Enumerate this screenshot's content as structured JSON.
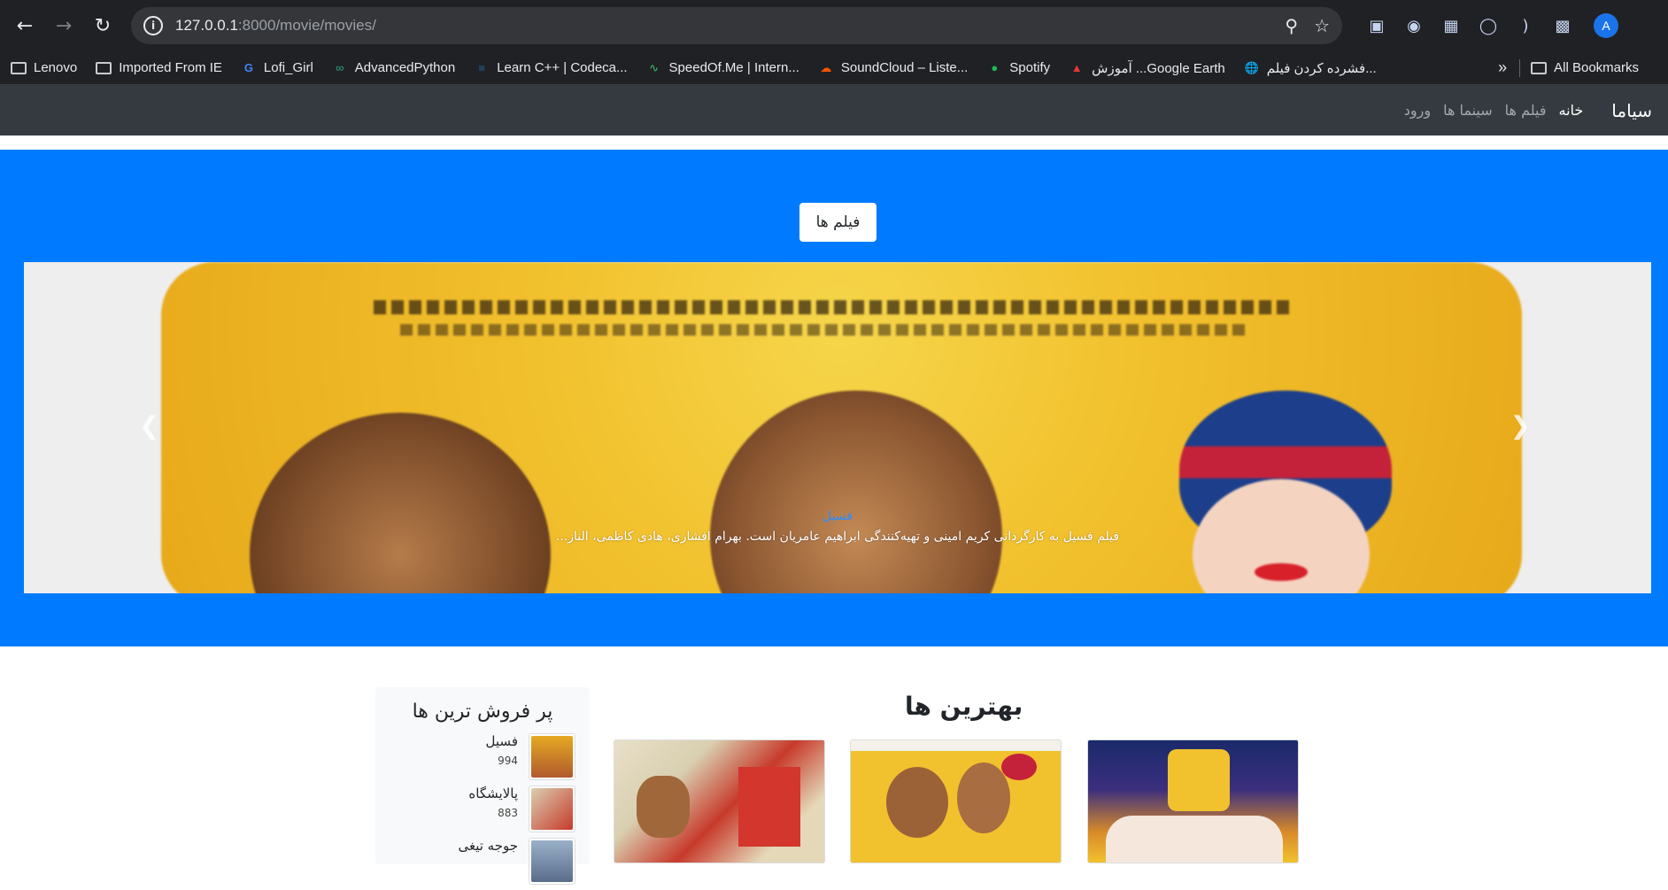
{
  "browser": {
    "url_host": "127.0.0.1",
    "url_rest": ":8000/movie/movies/",
    "avatar_letter": "A"
  },
  "bookmarks": [
    {
      "label": "Lenovo",
      "icon": "folder-icon"
    },
    {
      "label": "Imported From IE",
      "icon": "folder-icon"
    },
    {
      "label": "Lofi_Girl",
      "icon": "google-icon"
    },
    {
      "label": "AdvancedPython",
      "icon": "site-icon"
    },
    {
      "label": "Learn C++ | Codeca...",
      "icon": "codecademy-icon"
    },
    {
      "label": "SpeedOf.Me | Intern...",
      "icon": "speedofme-icon"
    },
    {
      "label": "SoundCloud – Liste...",
      "icon": "soundcloud-icon"
    },
    {
      "label": "Spotify",
      "icon": "spotify-icon"
    },
    {
      "label": "آموزش ...Google Earth",
      "icon": "google-earth-icon"
    },
    {
      "label": "فشرده کردن فیلم...",
      "icon": "globe-icon"
    }
  ],
  "bookmarks_all": "All Bookmarks",
  "site_nav": {
    "brand": "سیاما",
    "links": [
      "خانه",
      "فیلم ها",
      "سینما ها",
      "ورود"
    ]
  },
  "hero": {
    "title": "فیلم ها",
    "caption_title": "فسیل",
    "caption_text": "فیلم فسیل به کارگردانی کریم امینی و تهیه‌کنندگی ابراهیم عامریان است. بهرام افشاری، هادی کاظمی، الناز..."
  },
  "best": {
    "title": "بهترین ها"
  },
  "bestsellers": {
    "title": "پر فروش ترین ها",
    "items": [
      {
        "name": "فسیل",
        "count": "994"
      },
      {
        "name": "پالایشگاه",
        "count": "883"
      },
      {
        "name": "جوجه تیغی",
        "count": ""
      }
    ]
  },
  "colors": {
    "hero_bg": "#007bff",
    "navbar_bg": "#343a40",
    "chrome_bg": "#202124"
  }
}
